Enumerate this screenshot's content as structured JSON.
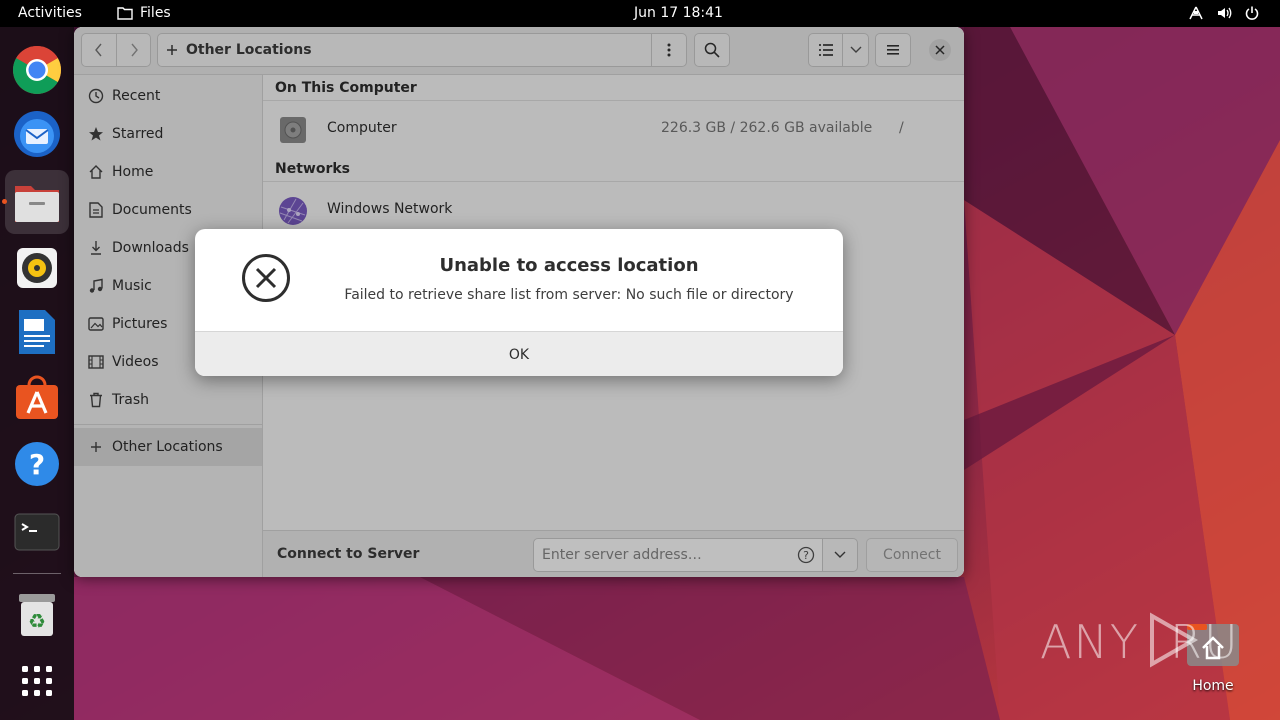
{
  "topbar": {
    "activities": "Activities",
    "app_name": "Files",
    "clock": "Jun 17  18:41"
  },
  "dock": {
    "items": [
      "Google Chrome",
      "Thunderbird Mail",
      "Files",
      "Rhythmbox",
      "LibreOffice Writer",
      "Ubuntu Software",
      "Help",
      "Terminal",
      "Trash",
      "Show Applications"
    ]
  },
  "window": {
    "path": {
      "location": "Other Locations"
    },
    "sidebar": {
      "items": [
        {
          "label": "Recent",
          "icon": "clock-icon"
        },
        {
          "label": "Starred",
          "icon": "star-icon"
        },
        {
          "label": "Home",
          "icon": "home-icon"
        },
        {
          "label": "Documents",
          "icon": "document-icon"
        },
        {
          "label": "Downloads",
          "icon": "download-icon"
        },
        {
          "label": "Music",
          "icon": "music-icon"
        },
        {
          "label": "Pictures",
          "icon": "picture-icon"
        },
        {
          "label": "Videos",
          "icon": "video-icon"
        },
        {
          "label": "Trash",
          "icon": "trash-icon"
        }
      ],
      "other_locations": "Other Locations"
    },
    "main": {
      "on_this_computer": "On This Computer",
      "computer": {
        "name": "Computer",
        "space": "226.3 GB / 262.6 GB available",
        "path": "/"
      },
      "networks": "Networks",
      "windows_network": "Windows Network"
    },
    "connect": {
      "label": "Connect to Server",
      "placeholder": "Enter server address…",
      "button": "Connect"
    }
  },
  "dialog": {
    "title": "Unable to access location",
    "message": "Failed to retrieve share list from server: No such file or directory",
    "ok": "OK"
  },
  "desktop": {
    "home_label": "Home",
    "watermark": "ANY RUN"
  }
}
